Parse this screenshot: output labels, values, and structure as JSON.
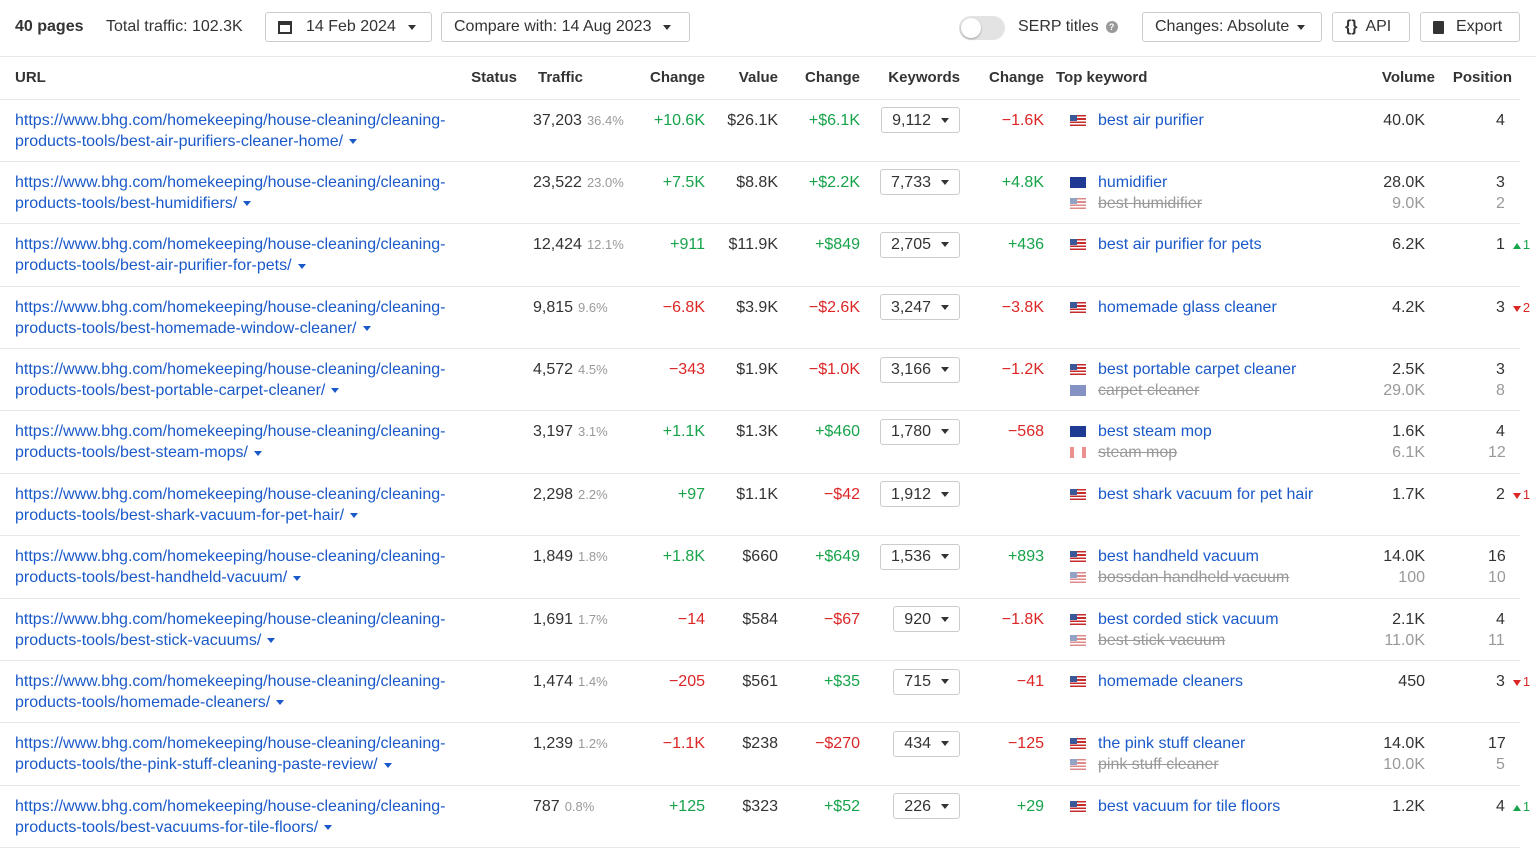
{
  "toolbar": {
    "pages": "40 pages",
    "total_traffic": "Total traffic: 102.3K",
    "date": "14 Feb 2024",
    "compare": "Compare with: 14 Aug 2023",
    "serp_titles": "SERP titles",
    "changes": "Changes: Absolute",
    "api": "API",
    "export": "Export"
  },
  "columns": [
    "URL",
    "Status",
    "Traffic",
    "Change",
    "Value",
    "Change",
    "Keywords",
    "Change",
    "Top keyword",
    "Volume",
    "Position"
  ],
  "rows": [
    {
      "url": "https://www.bhg.com/homekeeping/house-cleaning/cleaning-products-tools/best-air-purifiers-cleaner-home/",
      "traffic": "37,203",
      "pct": "36.4%",
      "tchange": "+10.6K",
      "tdir": "pos",
      "value": "$26.1K",
      "vchange": "+$6.1K",
      "vdir": "pos",
      "keywords": "9,112",
      "kchange": "−1.6K",
      "kdir": "neg",
      "kws": [
        {
          "flag": "us",
          "text": "best air purifier",
          "volume": "40.0K",
          "position": "4",
          "delta": "",
          "dir": ""
        }
      ]
    },
    {
      "url": "https://www.bhg.com/homekeeping/house-cleaning/cleaning-products-tools/best-humidifiers/",
      "traffic": "23,522",
      "pct": "23.0%",
      "tchange": "+7.5K",
      "tdir": "pos",
      "value": "$8.8K",
      "vchange": "+$2.2K",
      "vdir": "pos",
      "keywords": "7,733",
      "kchange": "+4.8K",
      "kdir": "pos",
      "kws": [
        {
          "flag": "au",
          "text": "humidifier",
          "volume": "28.0K",
          "position": "3",
          "delta": "",
          "dir": ""
        },
        {
          "flag": "us",
          "text": "best humidifier",
          "volume": "9.0K",
          "position": "2",
          "delta": "",
          "dir": "",
          "sec": true
        }
      ]
    },
    {
      "url": "https://www.bhg.com/homekeeping/house-cleaning/cleaning-products-tools/best-air-purifier-for-pets/",
      "traffic": "12,424",
      "pct": "12.1%",
      "tchange": "+911",
      "tdir": "pos",
      "value": "$11.9K",
      "vchange": "+$849",
      "vdir": "pos",
      "keywords": "2,705",
      "kchange": "+436",
      "kdir": "pos",
      "kws": [
        {
          "flag": "us",
          "text": "best air purifier for pets",
          "volume": "6.2K",
          "position": "1",
          "delta": "1",
          "dir": "up"
        }
      ]
    },
    {
      "url": "https://www.bhg.com/homekeeping/house-cleaning/cleaning-products-tools/best-homemade-window-cleaner/",
      "traffic": "9,815",
      "pct": "9.6%",
      "tchange": "−6.8K",
      "tdir": "neg",
      "value": "$3.9K",
      "vchange": "−$2.6K",
      "vdir": "neg",
      "keywords": "3,247",
      "kchange": "−3.8K",
      "kdir": "neg",
      "kws": [
        {
          "flag": "us",
          "text": "homemade glass cleaner",
          "volume": "4.2K",
          "position": "3",
          "delta": "2",
          "dir": "down"
        }
      ]
    },
    {
      "url": "https://www.bhg.com/homekeeping/house-cleaning/cleaning-products-tools/best-portable-carpet-cleaner/",
      "traffic": "4,572",
      "pct": "4.5%",
      "tchange": "−343",
      "tdir": "neg",
      "value": "$1.9K",
      "vchange": "−$1.0K",
      "vdir": "neg",
      "keywords": "3,166",
      "kchange": "−1.2K",
      "kdir": "neg",
      "kws": [
        {
          "flag": "us",
          "text": "best portable carpet cleaner",
          "volume": "2.5K",
          "position": "3",
          "delta": "",
          "dir": ""
        },
        {
          "flag": "au",
          "text": "carpet cleaner",
          "volume": "29.0K",
          "position": "8",
          "delta": "",
          "dir": "",
          "sec": true
        }
      ]
    },
    {
      "url": "https://www.bhg.com/homekeeping/house-cleaning/cleaning-products-tools/best-steam-mops/",
      "traffic": "3,197",
      "pct": "3.1%",
      "tchange": "+1.1K",
      "tdir": "pos",
      "value": "$1.3K",
      "vchange": "+$460",
      "vdir": "pos",
      "keywords": "1,780",
      "kchange": "−568",
      "kdir": "neg",
      "kws": [
        {
          "flag": "au",
          "text": "best steam mop",
          "volume": "1.6K",
          "position": "4",
          "delta": "",
          "dir": ""
        },
        {
          "flag": "ca",
          "text": "steam mop",
          "volume": "6.1K",
          "position": "12",
          "delta": "",
          "dir": "",
          "sec": true
        }
      ]
    },
    {
      "url": "https://www.bhg.com/homekeeping/house-cleaning/cleaning-products-tools/best-shark-vacuum-for-pet-hair/",
      "traffic": "2,298",
      "pct": "2.2%",
      "tchange": "+97",
      "tdir": "pos",
      "value": "$1.1K",
      "vchange": "−$42",
      "vdir": "neg",
      "keywords": "1,912",
      "kchange": "",
      "kdir": "",
      "kws": [
        {
          "flag": "us",
          "text": "best shark vacuum for pet hair",
          "volume": "1.7K",
          "position": "2",
          "delta": "1",
          "dir": "down"
        }
      ]
    },
    {
      "url": "https://www.bhg.com/homekeeping/house-cleaning/cleaning-products-tools/best-handheld-vacuum/",
      "traffic": "1,849",
      "pct": "1.8%",
      "tchange": "+1.8K",
      "tdir": "pos",
      "value": "$660",
      "vchange": "+$649",
      "vdir": "pos",
      "keywords": "1,536",
      "kchange": "+893",
      "kdir": "pos",
      "kws": [
        {
          "flag": "us",
          "text": "best handheld vacuum",
          "volume": "14.0K",
          "position": "16",
          "delta": "",
          "dir": ""
        },
        {
          "flag": "us",
          "text": "bossdan handheld vacuum",
          "volume": "100",
          "position": "10",
          "delta": "",
          "dir": "",
          "sec": true
        }
      ]
    },
    {
      "url": "https://www.bhg.com/homekeeping/house-cleaning/cleaning-products-tools/best-stick-vacuums/",
      "traffic": "1,691",
      "pct": "1.7%",
      "tchange": "−14",
      "tdir": "neg",
      "value": "$584",
      "vchange": "−$67",
      "vdir": "neg",
      "keywords": "920",
      "kchange": "−1.8K",
      "kdir": "neg",
      "kws": [
        {
          "flag": "us",
          "text": "best corded stick vacuum",
          "volume": "2.1K",
          "position": "4",
          "delta": "",
          "dir": ""
        },
        {
          "flag": "us",
          "text": "best stick vacuum",
          "volume": "11.0K",
          "position": "11",
          "delta": "",
          "dir": "",
          "sec": true
        }
      ]
    },
    {
      "url": "https://www.bhg.com/homekeeping/house-cleaning/cleaning-products-tools/homemade-cleaners/",
      "traffic": "1,474",
      "pct": "1.4%",
      "tchange": "−205",
      "tdir": "neg",
      "value": "$561",
      "vchange": "+$35",
      "vdir": "pos",
      "keywords": "715",
      "kchange": "−41",
      "kdir": "neg",
      "kws": [
        {
          "flag": "us",
          "text": "homemade cleaners",
          "volume": "450",
          "position": "3",
          "delta": "1",
          "dir": "down"
        }
      ]
    },
    {
      "url": "https://www.bhg.com/homekeeping/house-cleaning/cleaning-products-tools/the-pink-stuff-cleaning-paste-review/",
      "traffic": "1,239",
      "pct": "1.2%",
      "tchange": "−1.1K",
      "tdir": "neg",
      "value": "$238",
      "vchange": "−$270",
      "vdir": "neg",
      "keywords": "434",
      "kchange": "−125",
      "kdir": "neg",
      "kws": [
        {
          "flag": "us",
          "text": "the pink stuff cleaner",
          "volume": "14.0K",
          "position": "17",
          "delta": "",
          "dir": ""
        },
        {
          "flag": "us",
          "text": "pink stuff cleaner",
          "volume": "10.0K",
          "position": "5",
          "delta": "",
          "dir": "",
          "sec": true
        }
      ]
    },
    {
      "url": "https://www.bhg.com/homekeeping/house-cleaning/cleaning-products-tools/best-vacuums-for-tile-floors/",
      "traffic": "787",
      "pct": "0.8%",
      "tchange": "+125",
      "tdir": "pos",
      "value": "$323",
      "vchange": "+$52",
      "vdir": "pos",
      "keywords": "226",
      "kchange": "+29",
      "kdir": "pos",
      "kws": [
        {
          "flag": "us",
          "text": "best vacuum for tile floors",
          "volume": "1.2K",
          "position": "4",
          "delta": "1",
          "dir": "up"
        }
      ]
    }
  ]
}
